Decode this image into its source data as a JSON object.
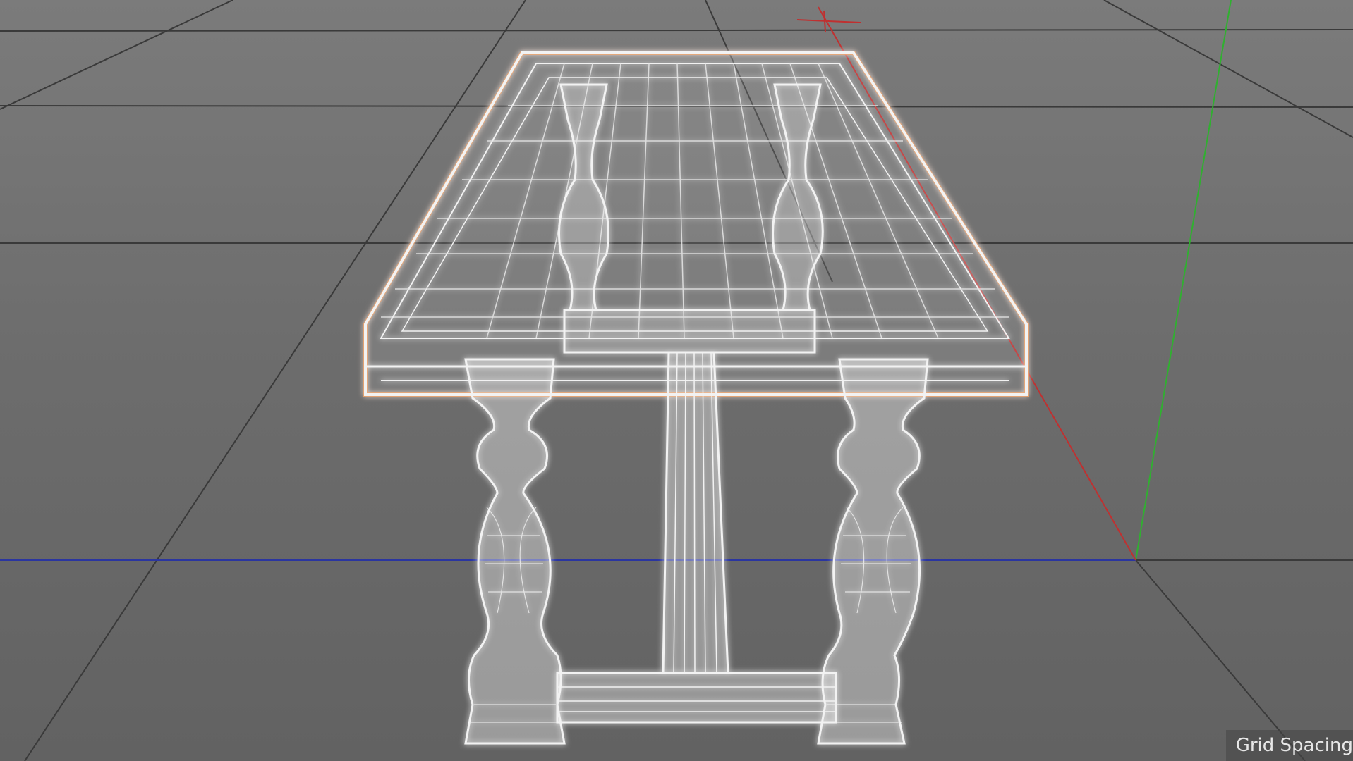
{
  "viewport": {
    "hud_text": "Grid Spacing"
  },
  "colors": {
    "background": "#6e6e6e",
    "grid_line": "#3a3a3a",
    "wire": "#f2f2f2",
    "selection_glow": "#f0a060",
    "axis_x": "#c03030",
    "axis_y": "#30b030",
    "axis_z": "#2a35a0"
  },
  "icons": {
    "world_axis": "axis-gizmo-icon"
  }
}
